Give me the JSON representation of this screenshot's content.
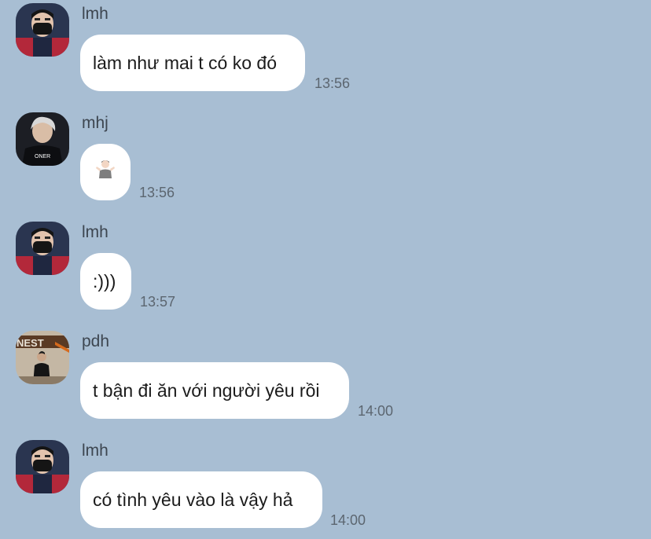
{
  "messages": [
    {
      "sender": "lmh",
      "text": "làm như mai t có ko đó",
      "time": "13:56",
      "avatar": "lmh-avatar"
    },
    {
      "sender": "mhj",
      "text": "",
      "emoji": "person-shrugging-emoji",
      "time": "13:56",
      "avatar": "mhj-avatar"
    },
    {
      "sender": "lmh",
      "text": ":)))",
      "time": "13:57",
      "avatar": "lmh-avatar"
    },
    {
      "sender": "pdh",
      "text": "t bận đi ăn với người yêu rồi",
      "time": "14:00",
      "avatar": "pdh-avatar"
    },
    {
      "sender": "lmh",
      "text": "có tình yêu vào là vậy hả",
      "time": "14:00",
      "avatar": "lmh-avatar"
    }
  ],
  "colors": {
    "background": "#a8bed3",
    "bubble": "#ffffff",
    "sender_text": "#3d4650",
    "time_text": "#5c6670"
  }
}
